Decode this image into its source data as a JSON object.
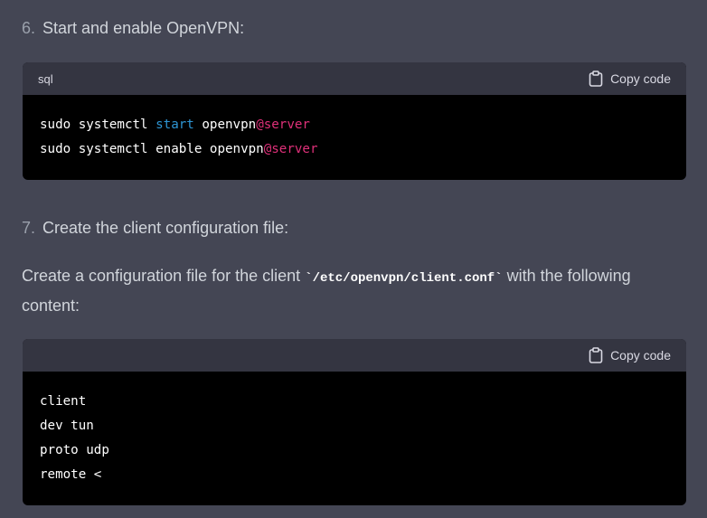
{
  "step6": {
    "number": "6.",
    "text": "Start and enable OpenVPN:"
  },
  "code1": {
    "lang": "sql",
    "copy_label": "Copy code",
    "lines": [
      {
        "a": "sudo systemctl ",
        "kw": "start",
        "b": " openvpn",
        "var": "@server"
      },
      {
        "a": "sudo systemctl enable openvpn",
        "var": "@server"
      }
    ]
  },
  "step7": {
    "number": "7.",
    "text": "Create the client configuration file:"
  },
  "paragraph": {
    "before": "Create a configuration file for the client ",
    "code": "`/etc/openvpn/client.conf`",
    "after": " with the following content:"
  },
  "code2": {
    "lang": "",
    "copy_label": "Copy code",
    "lines": [
      "client",
      "dev tun",
      "proto udp",
      "remote <"
    ]
  },
  "colors": {
    "page_bg": "#444654",
    "code_header_bg": "#343541",
    "code_body_bg": "#000000",
    "keyword": "#2e95d3",
    "variable": "#df3079"
  }
}
